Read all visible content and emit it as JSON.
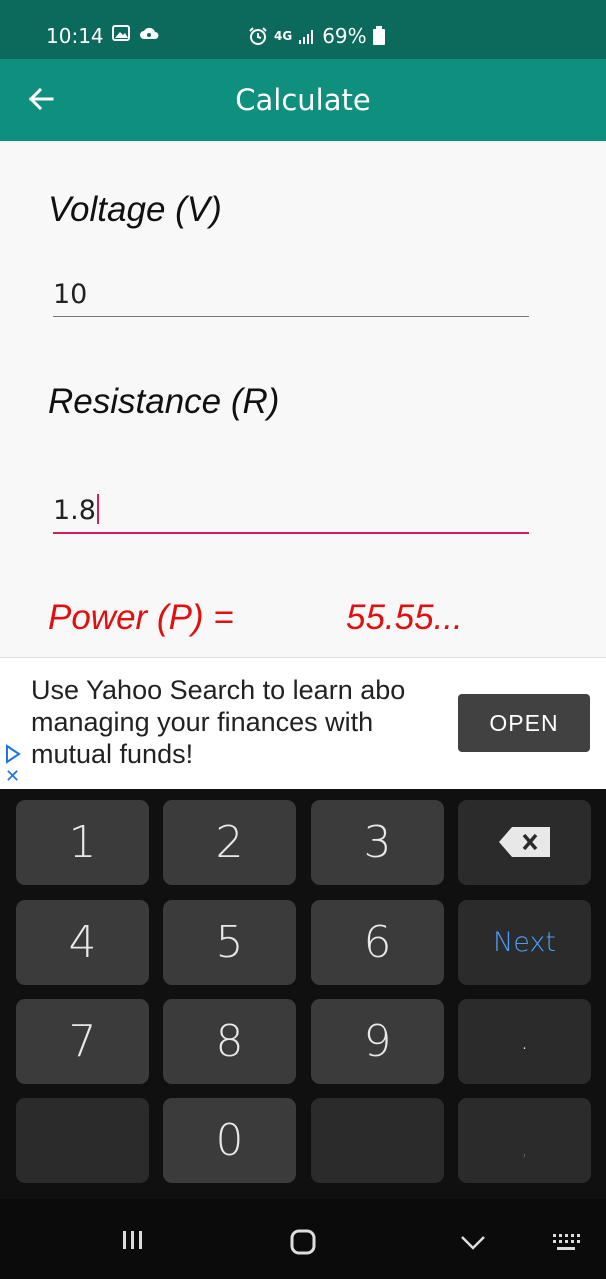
{
  "status_bar": {
    "time": "10:14",
    "network": "4G",
    "battery": "69%"
  },
  "app_bar": {
    "title": "Calculate"
  },
  "form": {
    "voltage_label": "Voltage (V)",
    "voltage_value": "10",
    "resistance_label": "Resistance (R)",
    "resistance_value": "1.8",
    "result_label": "Power (P) =",
    "result_value": "55.55..."
  },
  "ad": {
    "text": "Use Yahoo Search to learn abo\nmanaging your finances with\nmutual funds!",
    "button_label": "OPEN"
  },
  "keyboard": {
    "keys": [
      "1",
      "2",
      "3",
      "4",
      "5",
      "6",
      "Next",
      "7",
      "8",
      "9",
      ".",
      "0",
      ","
    ]
  },
  "colors": {
    "status_bar": "#0c6a5d",
    "app_bar": "#0f8f7d",
    "accent": "#d81b60",
    "result": "#e01010",
    "next_key": "#4a9ff5"
  }
}
